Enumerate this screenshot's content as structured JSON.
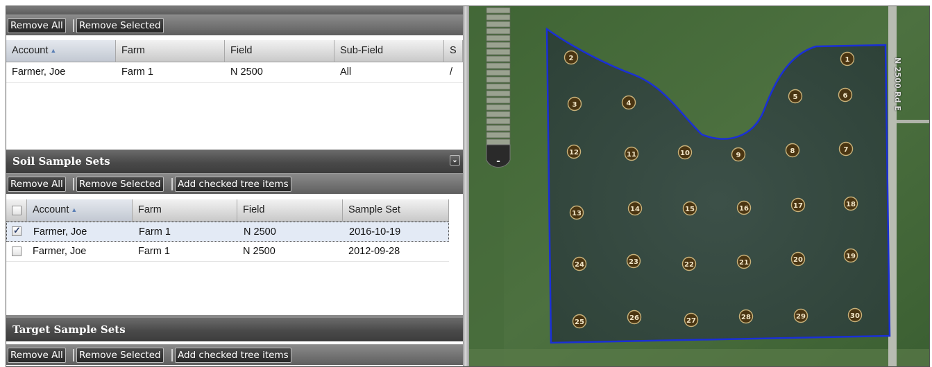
{
  "fields_panel": {
    "toolbar": {
      "remove_all": "Remove All",
      "remove_selected": "Remove Selected"
    },
    "columns": [
      "Account",
      "Farm",
      "Field",
      "Sub-Field",
      "S"
    ],
    "rows": [
      {
        "account": "Farmer, Joe",
        "farm": "Farm 1",
        "field": "N 2500",
        "subfield": "All",
        "extra": "/"
      }
    ]
  },
  "soil_panel": {
    "title": "Soil Sample Sets",
    "toolbar": {
      "remove_all": "Remove All",
      "remove_selected": "Remove Selected",
      "add_checked": "Add checked tree items"
    },
    "columns": [
      "Account",
      "Farm",
      "Field",
      "Sample Set"
    ],
    "rows": [
      {
        "checked": true,
        "account": "Farmer, Joe",
        "farm": "Farm 1",
        "field": "N 2500",
        "sample_set": "2016-10-19"
      },
      {
        "checked": false,
        "account": "Farmer, Joe",
        "farm": "Farm 1",
        "field": "N 2500",
        "sample_set": "2012-09-28"
      }
    ]
  },
  "target_panel": {
    "title": "Target Sample Sets",
    "toolbar": {
      "remove_all": "Remove All",
      "remove_selected": "Remove Selected",
      "add_checked": "Add checked tree items"
    }
  },
  "map": {
    "road_label": "N 2500 Rd E",
    "zoom_out_label": "-",
    "boundary_color": "#1a2fd6",
    "point_fill": "#4a3512",
    "point_label_color": "#f2e6c8",
    "sample_points": [
      "1",
      "2",
      "3",
      "4",
      "5",
      "6",
      "7",
      "8",
      "9",
      "10",
      "11",
      "12",
      "13",
      "14",
      "15",
      "16",
      "17",
      "18",
      "19",
      "20",
      "21",
      "22",
      "23",
      "24",
      "25",
      "26",
      "27",
      "28",
      "29",
      "30"
    ]
  },
  "colors": {
    "header_dark": "#4a4a4a",
    "selected_row": "#e3eaf5",
    "sort_arrow": "#5a7fb5"
  }
}
